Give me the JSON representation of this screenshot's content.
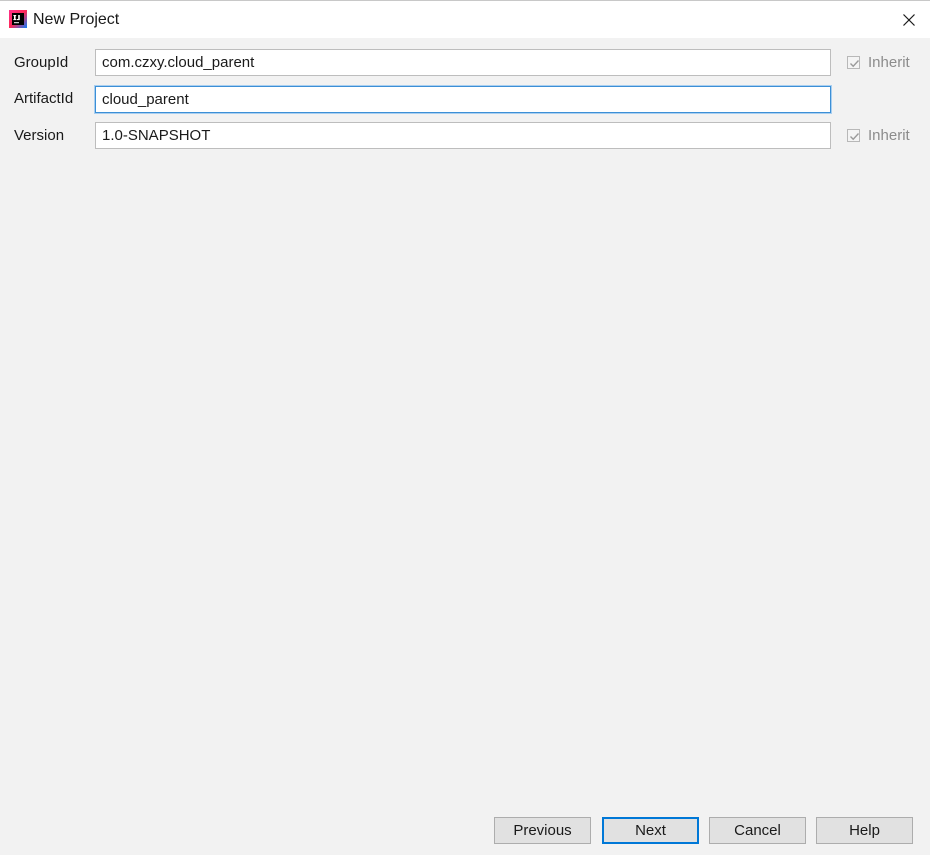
{
  "window": {
    "title": "New Project"
  },
  "form": {
    "fields": [
      {
        "label": "GroupId",
        "value": "com.czxy.cloud_parent",
        "inherit": true
      },
      {
        "label": "ArtifactId",
        "value": "cloud_parent"
      },
      {
        "label": "Version",
        "value": "1.0-SNAPSHOT",
        "inherit": true
      }
    ],
    "inherit_label": "Inherit"
  },
  "buttons": {
    "previous": "Previous",
    "next": "Next",
    "cancel": "Cancel",
    "help": "Help"
  },
  "colors": {
    "accent": "#0078d7",
    "focus_border": "#3c8fd6",
    "background": "#f2f2f2"
  }
}
